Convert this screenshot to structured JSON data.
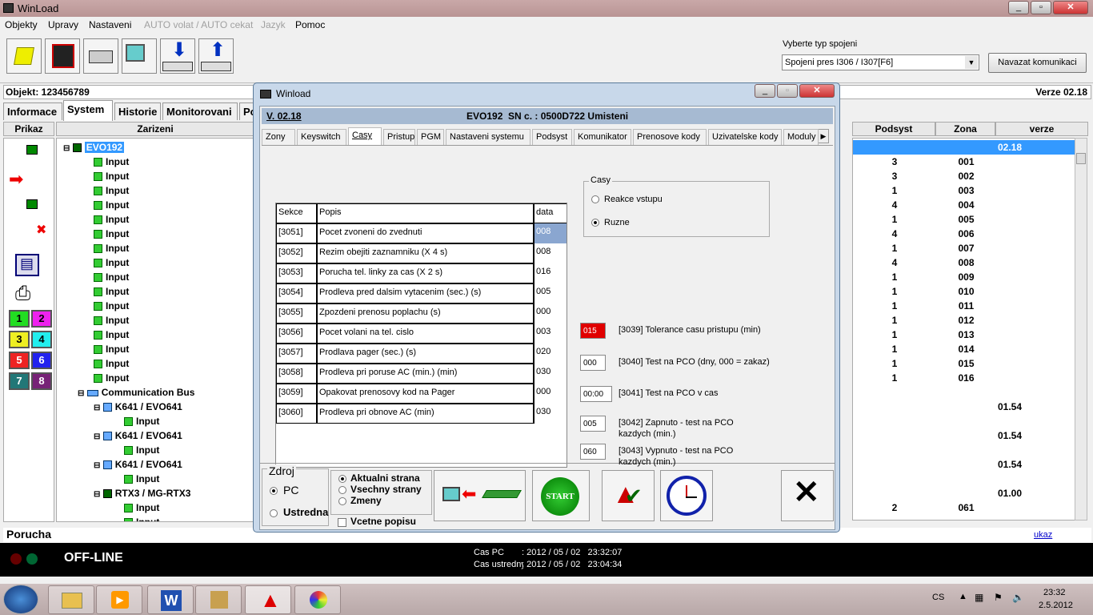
{
  "app": {
    "title": "WinLoad"
  },
  "menu": [
    "Objekty",
    "Upravy",
    "Nastaveni",
    "AUTO volat / AUTO cekat",
    "Jazyk",
    "Pomoc"
  ],
  "connection": {
    "label": "Vyberte typ spojeni",
    "selected": "Spojeni pres I306 / I307[F6]",
    "button": "Navazat komunikaci"
  },
  "object": {
    "label": "Objekt: 123456789",
    "version": "Verze 02.18"
  },
  "tabs": [
    "Informace",
    "System",
    "Historie",
    "Monitorovani",
    "Po"
  ],
  "headers": {
    "prikaz": "Prikaz",
    "zarizeni": "Zarizeni",
    "podsyst": "Podsyst",
    "zona": "Zona",
    "verze": "verze"
  },
  "tree": {
    "root": "EVO192",
    "input": "Input",
    "bus": "Communication Bus",
    "k641": "K641 / EVO641",
    "rtx3": "RTX3 / MG-RTX3"
  },
  "grid_rows": [
    {
      "podsyst": "",
      "zona": "",
      "verze": "02.18"
    },
    {
      "podsyst": "3",
      "zona": "001",
      "verze": ""
    },
    {
      "podsyst": "3",
      "zona": "002",
      "verze": ""
    },
    {
      "podsyst": "1",
      "zona": "003",
      "verze": ""
    },
    {
      "podsyst": "4",
      "zona": "004",
      "verze": ""
    },
    {
      "podsyst": "1",
      "zona": "005",
      "verze": ""
    },
    {
      "podsyst": "4",
      "zona": "006",
      "verze": ""
    },
    {
      "podsyst": "1",
      "zona": "007",
      "verze": ""
    },
    {
      "podsyst": "4",
      "zona": "008",
      "verze": ""
    },
    {
      "podsyst": "1",
      "zona": "009",
      "verze": ""
    },
    {
      "podsyst": "1",
      "zona": "010",
      "verze": ""
    },
    {
      "podsyst": "1",
      "zona": "011",
      "verze": ""
    },
    {
      "podsyst": "1",
      "zona": "012",
      "verze": ""
    },
    {
      "podsyst": "1",
      "zona": "013",
      "verze": ""
    },
    {
      "podsyst": "1",
      "zona": "014",
      "verze": ""
    },
    {
      "podsyst": "1",
      "zona": "015",
      "verze": ""
    },
    {
      "podsyst": "1",
      "zona": "016",
      "verze": ""
    },
    {
      "podsyst": "",
      "zona": "",
      "verze": ""
    },
    {
      "podsyst": "",
      "zona": "",
      "verze": "01.54"
    },
    {
      "podsyst": "",
      "zona": "",
      "verze": ""
    },
    {
      "podsyst": "",
      "zona": "",
      "verze": "01.54"
    },
    {
      "podsyst": "",
      "zona": "",
      "verze": ""
    },
    {
      "podsyst": "",
      "zona": "",
      "verze": "01.54"
    },
    {
      "podsyst": "",
      "zona": "",
      "verze": ""
    },
    {
      "podsyst": "",
      "zona": "",
      "verze": "01.00"
    },
    {
      "podsyst": "2",
      "zona": "061",
      "verze": ""
    }
  ],
  "color_keys": [
    "1",
    "2",
    "3",
    "4",
    "5",
    "6",
    "7",
    "8"
  ],
  "porucha": {
    "label": "Porucha",
    "link": "ukaz"
  },
  "status": {
    "state": "OFF-LINE",
    "cas_pc_label": "Cas PC",
    "cas_pc": ": 2012 / 05 / 02   23:32:07",
    "cas_ustr_label": "Cas ustredny",
    "cas_ustr": ": 2012 / 05 / 02   23:04:34"
  },
  "dialog": {
    "title": "Winload",
    "version": "V. 02.18",
    "panel": "EVO192  SN c. : 0500D722 Umisteni",
    "tabs": [
      "Zony",
      "Keyswitch",
      "Casy",
      "Pristup",
      "PGM",
      "Nastaveni systemu",
      "Podsyst",
      "Komunikator",
      "Prenosove kody",
      "Uzivatelske kody",
      "Moduly"
    ],
    "table_headers": {
      "sekce": "Sekce",
      "popis": "Popis",
      "data": "data"
    },
    "rows": [
      {
        "sekce": "[3051]",
        "popis": "Pocet zvoneni do zvednuti",
        "data": "008"
      },
      {
        "sekce": "[3052]",
        "popis": "Rezim obejiti zaznamniku (X 4 s)",
        "data": "008"
      },
      {
        "sekce": "[3053]",
        "popis": "Porucha tel. linky za cas (X 2 s)",
        "data": "016"
      },
      {
        "sekce": "[3054]",
        "popis": "Prodleva pred dalsim vytacenim (sec.) (s)",
        "data": "005"
      },
      {
        "sekce": "[3055]",
        "popis": "Zpozdeni prenosu poplachu (s)",
        "data": "000"
      },
      {
        "sekce": "[3056]",
        "popis": "Pocet volani na tel. cislo",
        "data": "003"
      },
      {
        "sekce": "[3057]",
        "popis": "Prodlava pager (sec.) (s)",
        "data": "020"
      },
      {
        "sekce": "[3058]",
        "popis": "Prodleva pri poruse AC (min.) (min)",
        "data": "030"
      },
      {
        "sekce": "[3059]",
        "popis": "Opakovat prenosovy kod na Pager",
        "data": "000"
      },
      {
        "sekce": "[3060]",
        "popis": "Prodleva pri obnove AC (min)",
        "data": "030"
      }
    ],
    "casy": {
      "title": "Casy",
      "opt1": "Reakce vstupu",
      "opt2": "Ruzne"
    },
    "fields": [
      {
        "value": "015",
        "label": "[3039] Tolerance casu pristupu (min)"
      },
      {
        "value": "000",
        "label": "[3040] Test na PCO (dny, 000 = zakaz)"
      },
      {
        "value": "00:00",
        "label": "[3041] Test na PCO v cas"
      },
      {
        "value": "005",
        "label": "[3042] Zapnuto - test na PCO kazdych (min.)"
      },
      {
        "value": "060",
        "label": "[3043] Vypnuto - test na PCO kazdych (min.)"
      }
    ],
    "zdroj": {
      "title": "Zdroj",
      "pc": "PC",
      "ustredna": "Ustredna"
    },
    "strana": {
      "aktualni": "Aktualni strana",
      "vsechny": "Vsechny strany",
      "zmeny": "Zmeny",
      "popis": "Vcetne popisu"
    },
    "start": "START",
    "highlight_color": "#e00000"
  },
  "taskbar": {
    "lang": "CS",
    "time": "23:32",
    "date": "2.5.2012"
  }
}
